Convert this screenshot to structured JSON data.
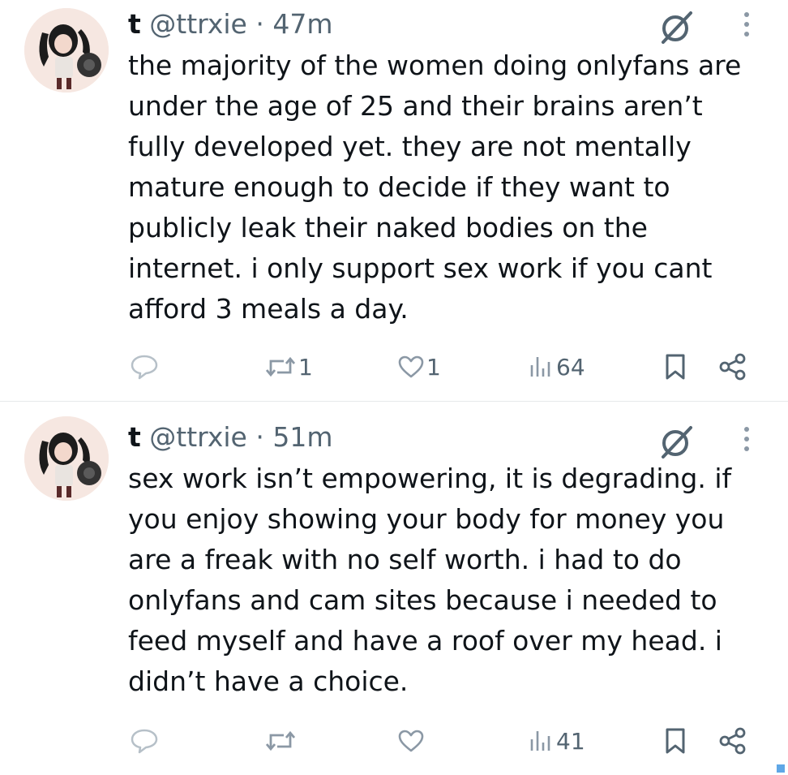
{
  "tweets": [
    {
      "display_name": "t",
      "handle": "@ttrxie",
      "separator": "·",
      "time": "47m",
      "text_lines": [
        "the majority of the women doing onlyfans are",
        "under the age of 25 and their brains aren’t",
        "fully developed yet. they are not mentally",
        "mature enough to decide if they want to",
        "publicly leak their naked bodies on the",
        "internet. i only support sex work if you cant",
        "afford 3 meals a day."
      ],
      "reposts": "1",
      "likes": "1",
      "views": "64"
    },
    {
      "display_name": "t",
      "handle": "@ttrxie",
      "separator": "·",
      "time": "51m",
      "text_lines": [
        "sex work isn’t empowering, it is degrading. if",
        "you enjoy showing your body for money you",
        "are a freak with no self worth. i had to do",
        "onlyfans and cam sites because i needed to",
        "feed myself and have a roof over my head. i",
        "didn’t have a choice."
      ],
      "reposts": "",
      "likes": "",
      "views": "41"
    }
  ],
  "icons": {
    "reply": "reply-icon",
    "repost": "repost-icon",
    "like": "heart-icon",
    "views": "views-icon",
    "bookmark": "bookmark-icon",
    "share": "share-icon",
    "grok": "grok-icon",
    "more": "more-icon"
  },
  "colors": {
    "text": "#0f1419",
    "secondary": "#536471",
    "icon": "#8b98a5",
    "divider": "#e6e9eb"
  }
}
